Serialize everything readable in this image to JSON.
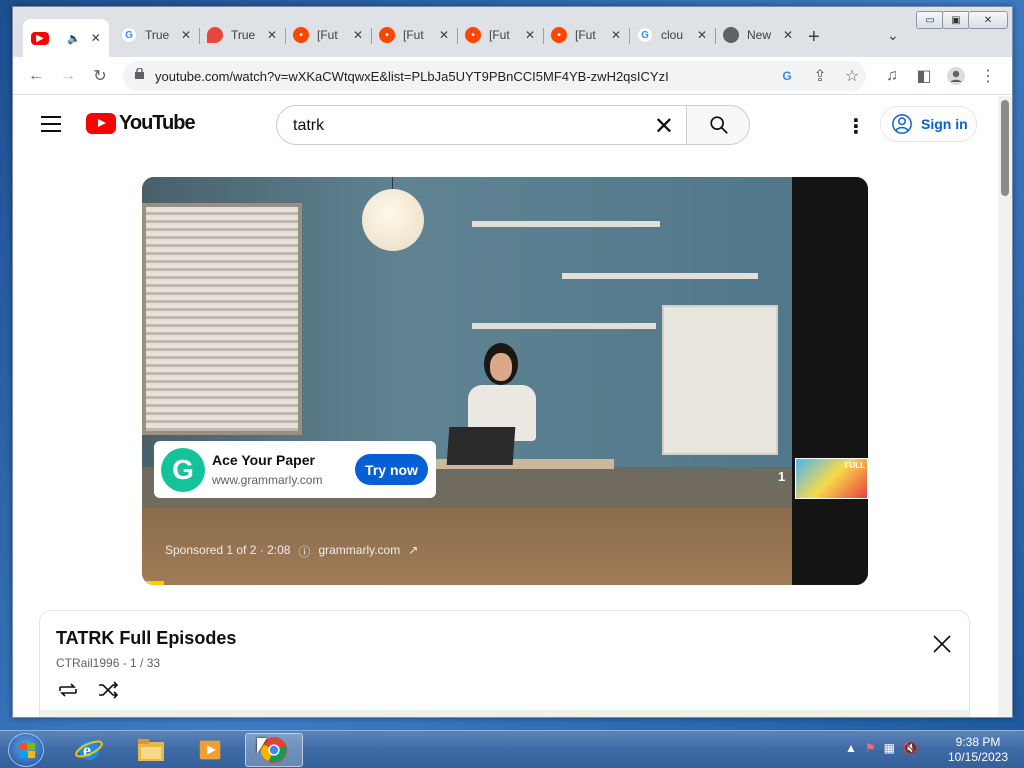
{
  "browser": {
    "tabs": [
      {
        "title": "",
        "favicon": "youtube-icon",
        "color": "#ff0000",
        "active": true,
        "audio": true
      },
      {
        "title": "True",
        "favicon": "google-icon",
        "color": "#4285f4"
      },
      {
        "title": "True",
        "favicon": "fire-icon",
        "color": "#e8453c"
      },
      {
        "title": "[Fut",
        "favicon": "reddit-icon",
        "color": "#ff4500"
      },
      {
        "title": "[Fut",
        "favicon": "reddit-icon",
        "color": "#ff4500"
      },
      {
        "title": "[Fut",
        "favicon": "reddit-icon",
        "color": "#ff4500"
      },
      {
        "title": "[Fut",
        "favicon": "reddit-icon",
        "color": "#ff4500"
      },
      {
        "title": "clou",
        "favicon": "google-icon",
        "color": "#4285f4"
      },
      {
        "title": "New",
        "favicon": "chrome-icon",
        "color": "#5f6368"
      }
    ],
    "new_tab_label": "+",
    "tab_dropdown": "⌄",
    "window_controls": {
      "minimize": "▭",
      "maximize": "▣",
      "close": "✕"
    },
    "nav": {
      "back": "←",
      "forward": "→",
      "reload": "↻"
    },
    "url": "youtube.com/watch?v=wXKaCWtqwxE&list=PLbJa5UYT9PBnCCI5MF4YB-zwH2qsICYzI"
  },
  "youtube": {
    "logo_text": "YouTube",
    "search_query": "tatrk",
    "sign_in": "Sign in",
    "ad": {
      "headline": "Ace Your Paper",
      "domain": "www.grammarly.com",
      "cta": "Try now",
      "sponsored": "Sponsored 1 of 2 · 2:08",
      "link": "grammarly.com",
      "next_count": "1",
      "thumb_badge": "FULL"
    },
    "playlist": {
      "title": "TATRK Full Episodes",
      "meta": "CTRail1996 - 1 / 33"
    }
  },
  "taskbar": {
    "clock_time": "9:38 PM",
    "clock_date": "10/15/2023"
  }
}
